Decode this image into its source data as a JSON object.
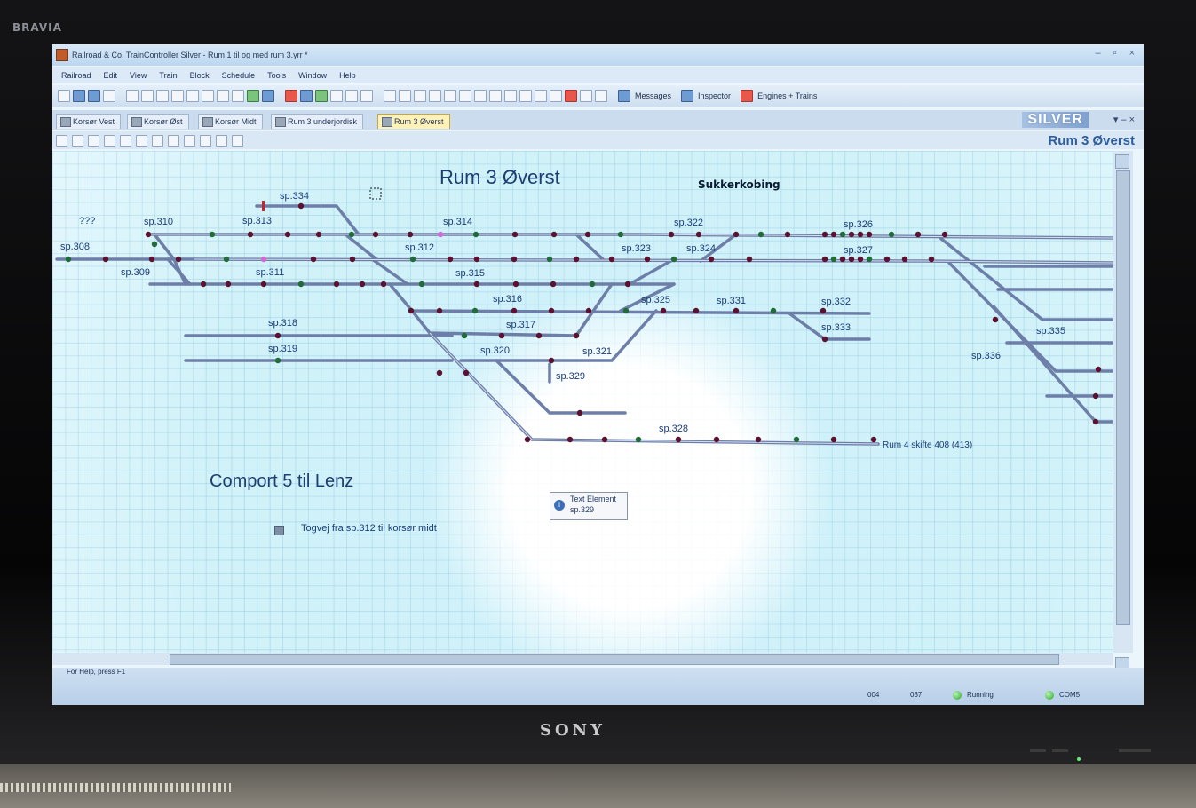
{
  "tv": {
    "brand": "BRAVIA",
    "maker": "SONY"
  },
  "app": {
    "title": "Railroad & Co. TrainController Silver - Rum 1 til og med rum 3.yrr *",
    "window_controls": [
      "–",
      "▫",
      "×"
    ]
  },
  "menu": [
    "Railroad",
    "Edit",
    "View",
    "Train",
    "Block",
    "Schedule",
    "Tools",
    "Window",
    "Help"
  ],
  "toolbar_labels": {
    "messages": "Messages",
    "inspector": "Inspector",
    "engines": "Engines + Trains"
  },
  "tabs": [
    {
      "label": "Korsør Vest",
      "active": false
    },
    {
      "label": "Korsør Øst",
      "active": false
    },
    {
      "label": "Korsør Midt",
      "active": false
    },
    {
      "label": "Rum 3 underjordisk",
      "active": false
    },
    {
      "label": "Rum 3 Øverst",
      "active": true
    }
  ],
  "edition": "SILVER",
  "tab_controls": "▾ – ×",
  "page_name": "Rum 3 Øverst",
  "canvas": {
    "heading": "Rum 3 Øverst",
    "place": "Sukkerkobing",
    "comport": "Comport 5 til Lenz",
    "route": "Togvej fra sp.312 til korsør midt",
    "unknown": "???",
    "exit_label": "Rum 4 skifte 408 (413)",
    "labels": {
      "sp308": "sp.308",
      "sp309": "sp.309",
      "sp310": "sp.310",
      "sp311": "sp.311",
      "sp312": "sp.312",
      "sp313": "sp.313",
      "sp314": "sp.314",
      "sp315": "sp.315",
      "sp316": "sp.316",
      "sp317": "sp.317",
      "sp318": "sp.318",
      "sp319": "sp.319",
      "sp320": "sp.320",
      "sp321": "sp.321",
      "sp322": "sp.322",
      "sp323": "sp.323",
      "sp324": "sp.324",
      "sp325": "sp.325",
      "sp326": "sp.326",
      "sp327": "sp.327",
      "sp328": "sp.328",
      "sp329": "sp.329",
      "sp331": "sp.331",
      "sp332": "sp.332",
      "sp333": "sp.333",
      "sp334": "sp.334",
      "sp335": "sp.335",
      "sp336": "sp.336"
    },
    "tooltip": {
      "title": "Text Element",
      "value": "sp.329"
    }
  },
  "status": {
    "help": "For Help, press F1",
    "cell1": "004",
    "cell2": "037",
    "running": "Running",
    "com": "COM5"
  },
  "colors": {
    "track": "#6d7fa8",
    "signal_dark": "#5a1230",
    "signal_green": "#1f6b3a",
    "signal_pink": "#d06ad9"
  }
}
